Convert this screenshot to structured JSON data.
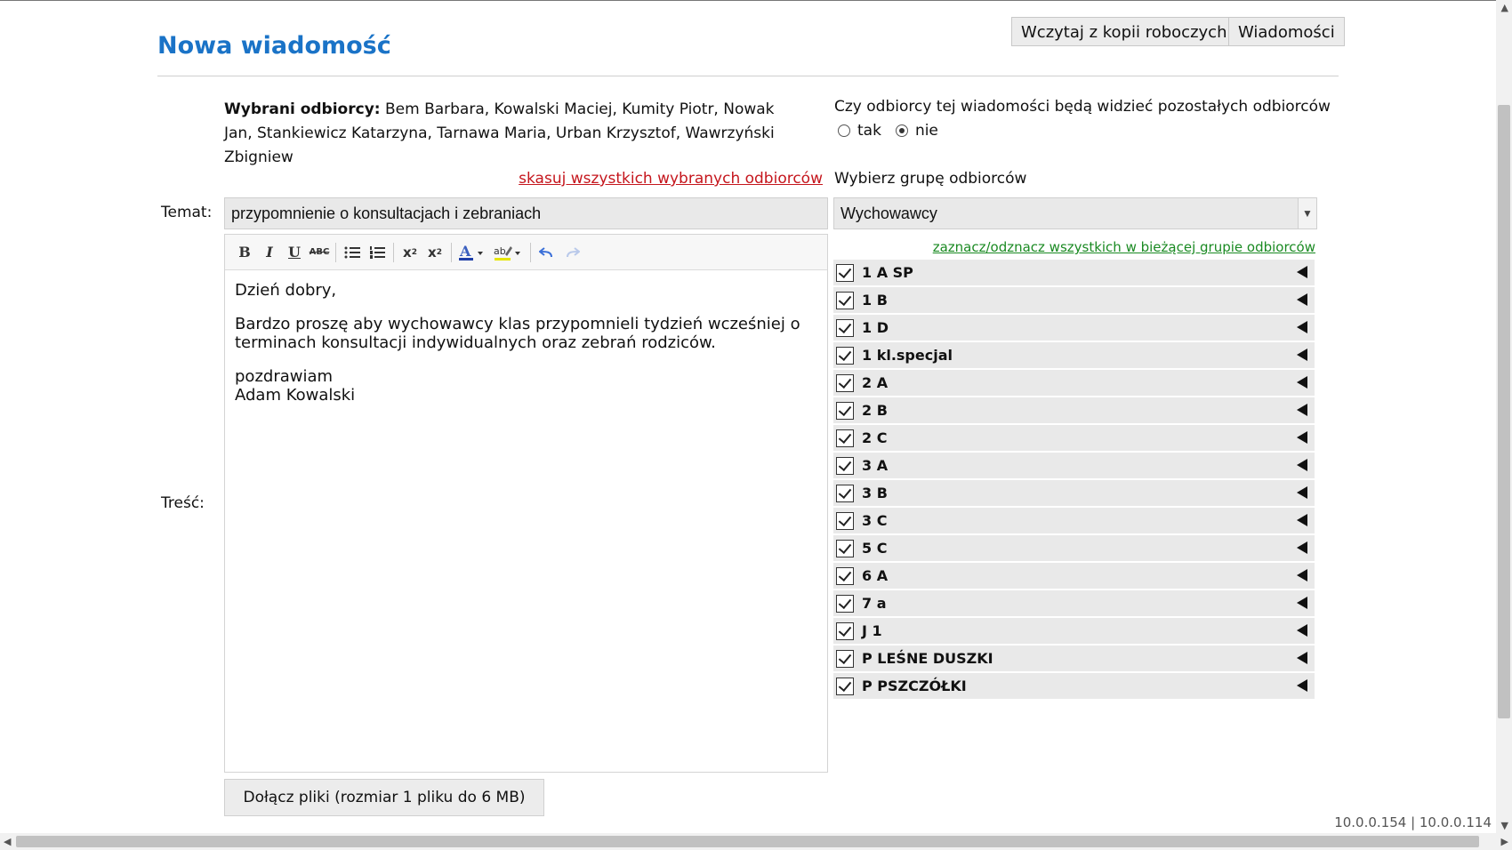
{
  "page": {
    "title": "Nowa wiadomość"
  },
  "header": {
    "drafts_button": "Wczytaj z kopii roboczych",
    "messages_button": "Wiadomości"
  },
  "recipients": {
    "label": "Wybrani odbiorcy:",
    "names": "Bem Barbara, Kowalski Maciej, Kumity Piotr, Nowak Jan, Stankiewicz Katarzyna, Tarnawa Maria, Urban Krzysztof, Wawrzyński Zbigniew",
    "delete_all_link": "skasuj wszystkich wybranych odbiorców"
  },
  "visibility": {
    "question": "Czy odbiorcy tej wiadomości będą widzieć pozostałych odbiorców",
    "yes": "tak",
    "no": "nie",
    "selected": "nie"
  },
  "form": {
    "subject_label": "Temat:",
    "subject_value": "przypomnienie o konsultacjach i zebraniach",
    "body_label": "Treść:",
    "body": {
      "greeting": "Dzień dobry,",
      "paragraph": "Bardzo proszę aby wychowawcy klas przypomnieli tydzień wcześniej o terminach konsultacji indywidualnych oraz zebrań rodziców.",
      "closing": "pozdrawiam",
      "signature": "Adam Kowalski"
    },
    "attach_button": "Dołącz pliki (rozmiar 1 pliku do 6 MB)"
  },
  "group_select": {
    "label": "Wybierz grupę odbiorców",
    "value": "Wychowawcy",
    "toggle_all_link": "zaznacz/odznacz wszystkich w bieżącej grupie odbiorców"
  },
  "groups": [
    {
      "name": "1 A SP",
      "checked": true
    },
    {
      "name": "1 B",
      "checked": true
    },
    {
      "name": "1 D",
      "checked": true
    },
    {
      "name": "1 kl.specjal",
      "checked": true
    },
    {
      "name": "2 A",
      "checked": true
    },
    {
      "name": "2 B",
      "checked": true
    },
    {
      "name": "2 C",
      "checked": true
    },
    {
      "name": "3 A",
      "checked": true
    },
    {
      "name": "3 B",
      "checked": true
    },
    {
      "name": "3 C",
      "checked": true
    },
    {
      "name": "5 C",
      "checked": true
    },
    {
      "name": "6 A",
      "checked": true
    },
    {
      "name": "7 a",
      "checked": true
    },
    {
      "name": "J 1",
      "checked": true
    },
    {
      "name": "P LEŚNE DUSZKI",
      "checked": true
    },
    {
      "name": "P PSZCZÓŁKI",
      "checked": true
    }
  ],
  "footer": {
    "version": "10.0.0.154 | 10.0.0.114"
  },
  "colors": {
    "title": "#1a73c7",
    "delete_link": "#c5161d",
    "toggle_link": "#1a8a22"
  }
}
